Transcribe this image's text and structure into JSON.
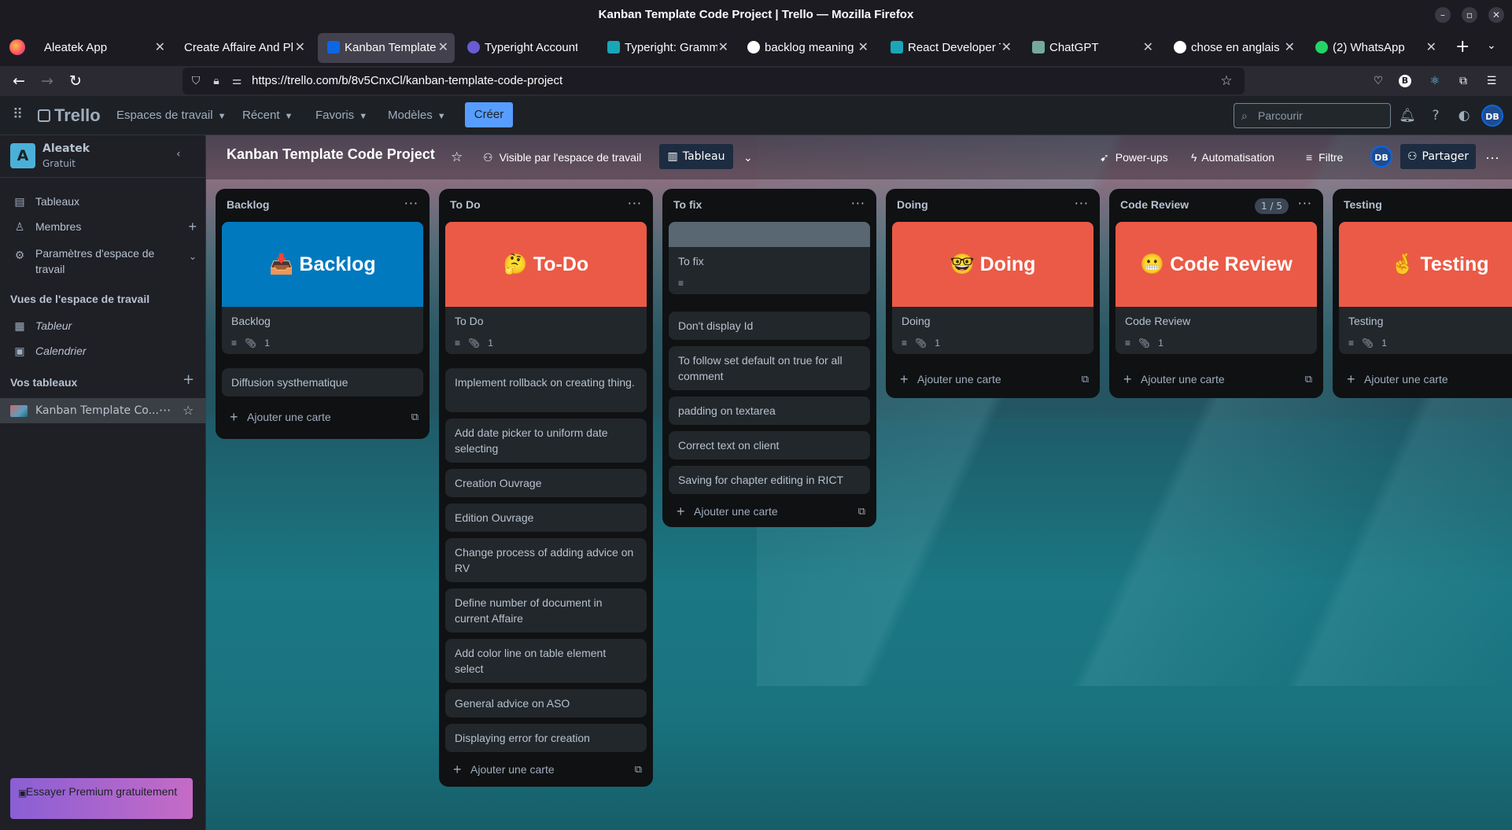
{
  "window": {
    "title": "Kanban Template Code Project | Trello — Mozilla Firefox"
  },
  "tabs": [
    {
      "label": "Aleatek App",
      "favicon_color": "#1c1b22"
    },
    {
      "label": "Create Affaire And Pl",
      "favicon_color": "#1c1b22"
    },
    {
      "label": "Kanban Template",
      "favicon_color": "#0c66e4"
    },
    {
      "label": "Typeright Account",
      "favicon_color": "#6b5bd2"
    },
    {
      "label": "Typeright: Gramm",
      "favicon_color": "#1aa6b7"
    },
    {
      "label": "backlog meaning",
      "favicon_color": "#ffffff"
    },
    {
      "label": "React Developer T",
      "favicon_color": "#1aa6b7"
    },
    {
      "label": "ChatGPT",
      "favicon_color": "#74aa9c"
    },
    {
      "label": "chose en anglais",
      "favicon_color": "#ffffff"
    },
    {
      "label": "(2) WhatsApp",
      "favicon_color": "#25d366"
    }
  ],
  "navbar": {
    "url": "https://trello.com/b/8v5CnxCl/kanban-template-code-project"
  },
  "header": {
    "logo": "Trello",
    "menus": [
      "Espaces de travail",
      "Récent",
      "Favoris",
      "Modèles"
    ],
    "create_label": "Créer",
    "search_placeholder": "Parcourir",
    "user_initials": "DB"
  },
  "sidebar": {
    "workspace_initial": "A",
    "workspace_name": "Aleatek",
    "workspace_plan": "Gratuit",
    "items": [
      {
        "label": "Tableaux"
      },
      {
        "label": "Membres"
      },
      {
        "label": "Paramètres d'espace de travail"
      }
    ],
    "views_title": "Vues de l'espace de travail",
    "views": [
      {
        "label": "Tableur"
      },
      {
        "label": "Calendrier"
      }
    ],
    "boards_title": "Vos tableaux",
    "boards": [
      {
        "label": "Kanban Template Co..."
      }
    ],
    "premium_label": "Essayer Premium gratuitement"
  },
  "board": {
    "title": "Kanban Template Code Project",
    "visibility": "Visible par l'espace de travail",
    "view": "Tableau",
    "powerups": "Power-ups",
    "automation": "Automatisation",
    "filter": "Filtre",
    "member_initials": "DB",
    "share": "Partager",
    "add_card_label": "Ajouter une carte",
    "lists": [
      {
        "title": "Backlog",
        "cover_card": {
          "cover_text": "📥 Backlog",
          "cover_color": "#0079bf",
          "title": "Backlog",
          "attachments": "1"
        },
        "cards": [
          "Diffusion systhematique"
        ]
      },
      {
        "title": "To Do",
        "cover_card": {
          "cover_text": "🤔 To-Do",
          "cover_color": "#eb5a46",
          "title": "To Do",
          "attachments": "1"
        },
        "cards": [
          "Implement rollback on creating thing.",
          "Add date picker to uniform date selecting",
          "Creation Ouvrage",
          "Edition Ouvrage",
          "Change process of adding advice on RV",
          "Define number of document in current Affaire",
          "Add color line on table element select",
          "General advice on ASO",
          "Displaying error for creation"
        ]
      },
      {
        "title": "To fix",
        "cover_card": {
          "cover_text": "",
          "cover_color": "#596773",
          "title": "To fix",
          "attachments": ""
        },
        "cards": [
          "Don't display Id",
          "To follow set default on true for all comment",
          "padding on textarea",
          "Correct text on client",
          "Saving for chapter editing in RICT"
        ]
      },
      {
        "title": "Doing",
        "cover_card": {
          "cover_text": "🤓 Doing",
          "cover_color": "#eb5a46",
          "title": "Doing",
          "attachments": "1"
        },
        "cards": []
      },
      {
        "title": "Code Review",
        "badge": "1 / 5",
        "cover_card": {
          "cover_text": "😬 Code Review",
          "cover_color": "#eb5a46",
          "title": "Code Review",
          "attachments": "1"
        },
        "cards": []
      },
      {
        "title": "Testing",
        "cover_card": {
          "cover_text": "🤞 Testing",
          "cover_color": "#eb5a46",
          "title": "Testing",
          "attachments": "1"
        },
        "cards": []
      }
    ]
  }
}
